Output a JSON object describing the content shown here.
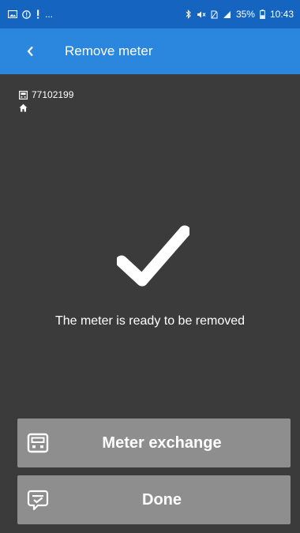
{
  "status_bar": {
    "left_icons": [
      "image-icon",
      "alert-icon",
      "exclamation-icon"
    ],
    "more_indicator": "...",
    "battery": "35%",
    "time": "10:43",
    "colors": {
      "background": "#1565c0"
    }
  },
  "toolbar": {
    "title": "Remove meter",
    "back_icon": "chevron-left-icon",
    "colors": {
      "background": "#2b86de"
    }
  },
  "meter_info": {
    "meter_number": "77102199",
    "meter_icon": "meter-icon",
    "location_icon": "home-icon"
  },
  "result": {
    "icon": "checkmark-icon",
    "message": "The meter is ready to be removed"
  },
  "actions": {
    "meter_exchange": {
      "label": "Meter exchange",
      "icon": "meter-icon"
    },
    "done": {
      "label": "Done",
      "icon": "checklist-icon"
    }
  },
  "colors": {
    "screen_background": "#3b3b3b",
    "button_background": "#8e8e8e",
    "text": "#ffffff"
  }
}
